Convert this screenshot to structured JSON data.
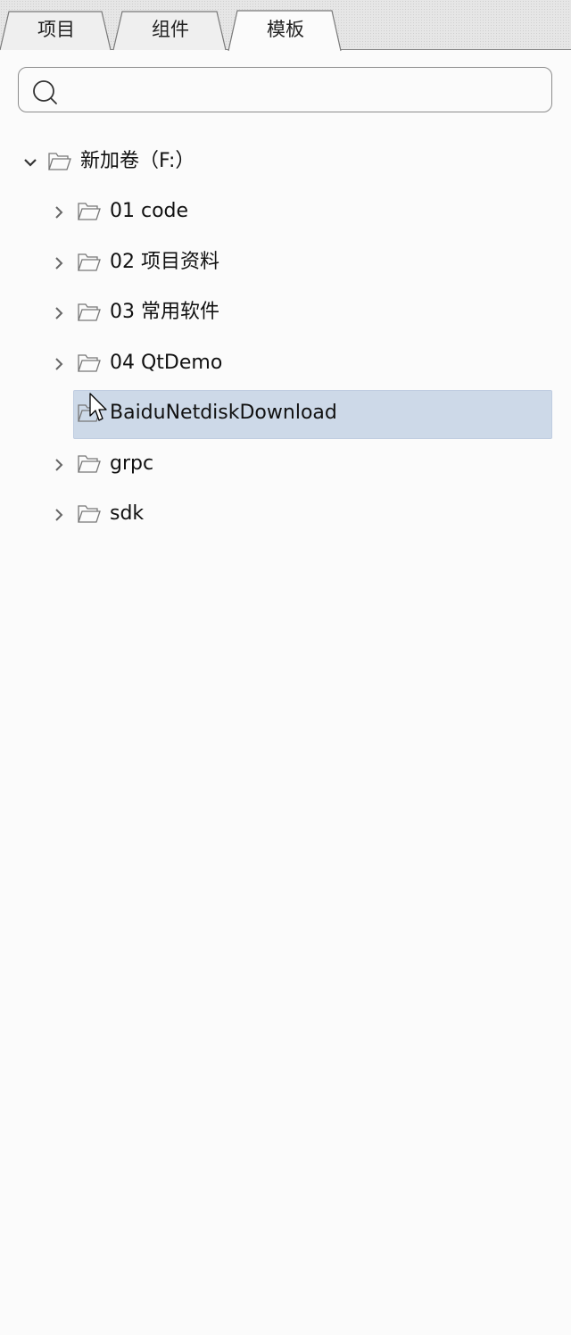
{
  "tabs": [
    {
      "label": "项目",
      "active": false
    },
    {
      "label": "组件",
      "active": false
    },
    {
      "label": "模板",
      "active": true
    }
  ],
  "search": {
    "value": "",
    "placeholder": ""
  },
  "tree": {
    "root": {
      "label": "新加卷（F:）",
      "expanded": true
    },
    "children": [
      {
        "label": "01 code",
        "expandable": true,
        "selected": false
      },
      {
        "label": "02 项目资料",
        "expandable": true,
        "selected": false
      },
      {
        "label": "03 常用软件",
        "expandable": true,
        "selected": false
      },
      {
        "label": "04 QtDemo",
        "expandable": true,
        "selected": false
      },
      {
        "label": "BaiduNetdiskDownload",
        "expandable": false,
        "selected": true
      },
      {
        "label": "grpc",
        "expandable": true,
        "selected": false
      },
      {
        "label": "sdk",
        "expandable": true,
        "selected": false
      }
    ]
  },
  "colors": {
    "selection": "#cdd9e8",
    "background": "#fbfbfb",
    "tab_active": "#fbfbfb",
    "tab_inactive": "#efefef"
  },
  "icons": {
    "search": "search-icon",
    "folder": "folder-icon",
    "expand": "chevron-right-icon",
    "collapse": "chevron-down-icon",
    "cursor": "mouse-pointer-icon"
  }
}
